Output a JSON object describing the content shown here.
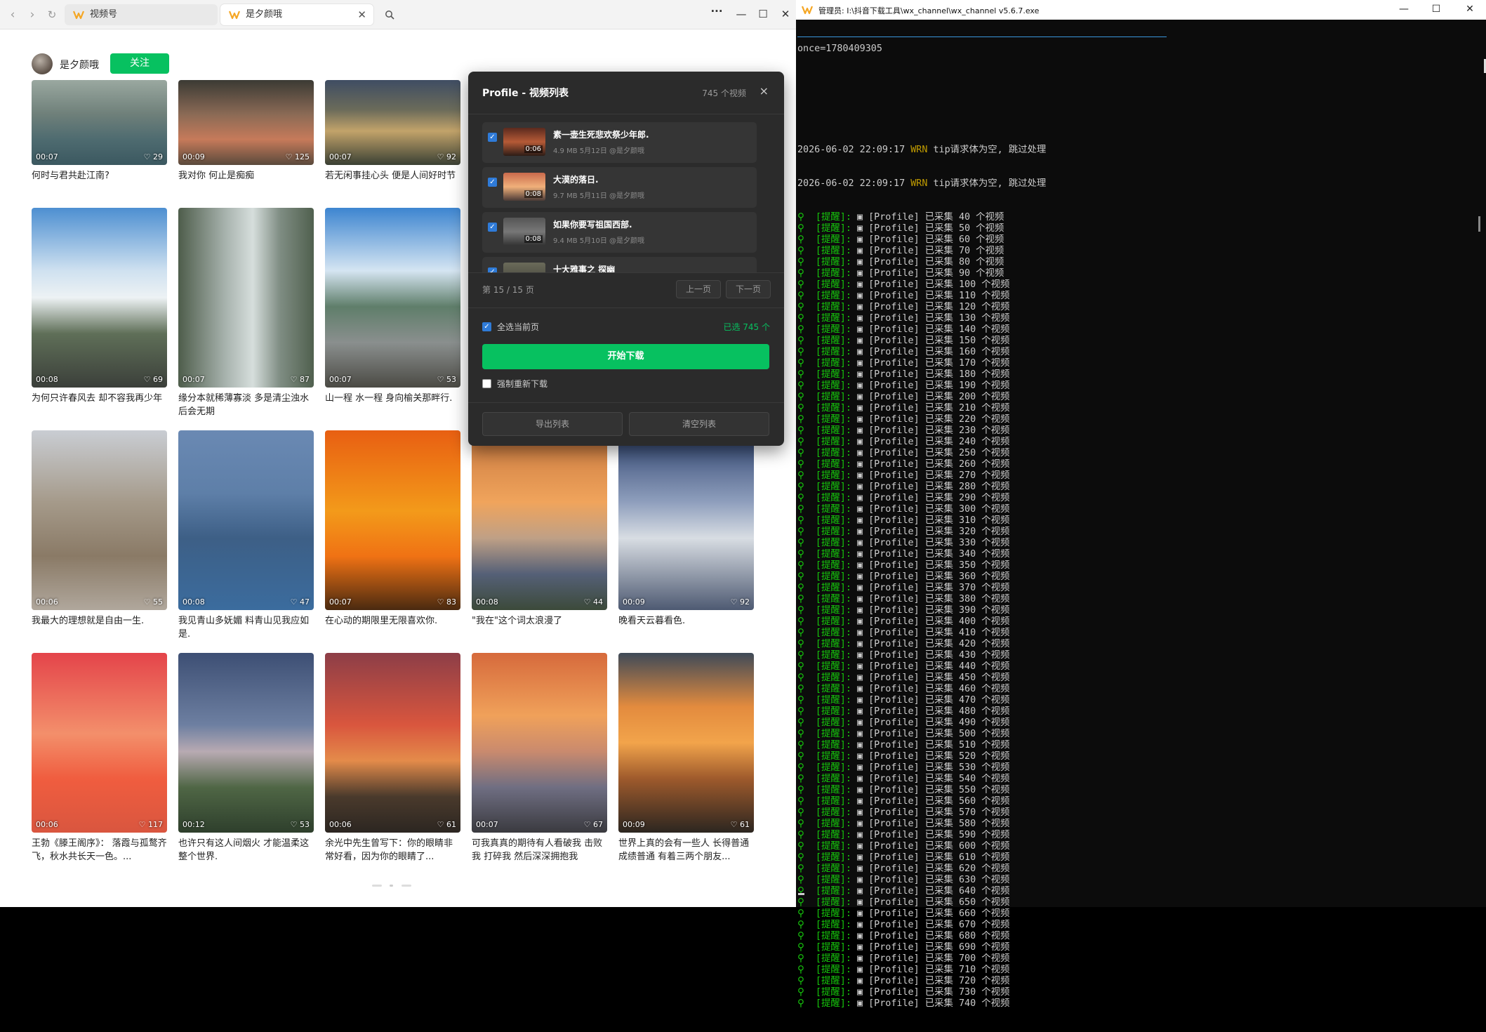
{
  "browser": {
    "tabs": [
      {
        "label": "视频号"
      },
      {
        "label": "是夕颜哦"
      }
    ]
  },
  "profile": {
    "name": "是夕颜哦",
    "follow_label": "关注"
  },
  "feed": [
    {
      "dur": "00:07",
      "likes": "29",
      "title": "何时与君共赴江南?"
    },
    {
      "dur": "00:09",
      "likes": "125",
      "title": "我对你 何止是痴痴"
    },
    {
      "dur": "00:07",
      "likes": "92",
      "title": "若无闲事挂心头 便是人间好时节"
    },
    {
      "dur": "00:08",
      "likes": "69",
      "title": "为何只许春风去 却不容我再少年"
    },
    {
      "dur": "00:07",
      "likes": "87",
      "title": "缘分本就稀薄寡淡 多是清尘浊水后会无期"
    },
    {
      "dur": "00:07",
      "likes": "53",
      "title": "山一程 水一程 身向榆关那畔行."
    },
    {
      "dur": "00:06",
      "likes": "55",
      "title": "我最大的理想就是自由一生."
    },
    {
      "dur": "00:08",
      "likes": "47",
      "title": "我见青山多妩媚 料青山见我应如是."
    },
    {
      "dur": "00:07",
      "likes": "83",
      "title": "在心动的期限里无限喜欢你."
    },
    {
      "dur": "00:08",
      "likes": "44",
      "title": "\"我在\"这个词太浪漫了"
    },
    {
      "dur": "00:09",
      "likes": "92",
      "title": "晚看天云暮看色."
    },
    {
      "dur": "00:06",
      "likes": "117",
      "title": "王勃《滕王阁序》： 落霞与孤鹜齐飞，秋水共长天一色。..."
    },
    {
      "dur": "00:12",
      "likes": "53",
      "title": "也许只有这人间烟火 才能温柔这整个世界."
    },
    {
      "dur": "00:06",
      "likes": "61",
      "title": "余光中先生曾写下：你的眼睛非常好看，因为你的眼睛了..."
    },
    {
      "dur": "00:07",
      "likes": "67",
      "title": "可我真真的期待有人看破我 击败我 打碎我 然后深深拥抱我"
    },
    {
      "dur": "00:09",
      "likes": "61",
      "title": "世界上真的会有一些人 长得普通 成绩普通 有着三两个朋友..."
    }
  ],
  "modal": {
    "title": "Profile - 视频列表",
    "count_label": "745 个视频",
    "close_glyph": "×",
    "items": [
      {
        "thumb_dur": "0:06",
        "title": "素一壶生死悲欢祭少年郎.",
        "size": "4.9 MB",
        "date": "5月12日",
        "author": "@是夕颜哦"
      },
      {
        "thumb_dur": "0:08",
        "title": "大漠的落日.",
        "size": "9.7 MB",
        "date": "5月11日",
        "author": "@是夕颜哦"
      },
      {
        "thumb_dur": "0:08",
        "title": "如果你要写祖国西部.",
        "size": "9.4 MB",
        "date": "5月10日",
        "author": "@是夕颜哦"
      },
      {
        "thumb_dur": "",
        "title": "十大雅事之 探幽",
        "size": "",
        "date": "",
        "author": ""
      }
    ],
    "page_label": "第 15 / 15 页",
    "prev_label": "上一页",
    "next_label": "下一页",
    "select_all_label": "全选当前页",
    "selected_label": "已选 745 个",
    "start_label": "开始下载",
    "force_label": "强制重新下载",
    "export_label": "导出列表",
    "clear_label": "清空列表"
  },
  "console": {
    "title": "管理员: I:\\抖音下载工具\\wx_channel\\wx_channel v5.6.7.exe",
    "nonce_line": "once=1780409305",
    "warn_lines": [
      {
        "time": "2026-06-02 22:09:17",
        "level": "WRN",
        "msg": "tip请求体为空, 跳过处理"
      },
      {
        "time": "2026-06-02 22:09:17",
        "level": "WRN",
        "msg": "tip请求体为空, 跳过处理"
      }
    ],
    "log_tag": "[提醒]:",
    "log_prefix": "[Profile] 已采集",
    "log_suffix": "个视频",
    "counts": [
      40,
      50,
      60,
      70,
      80,
      90,
      100,
      110,
      120,
      130,
      140,
      150,
      160,
      170,
      180,
      190,
      200,
      210,
      220,
      230,
      240,
      250,
      260,
      270,
      280,
      290,
      300,
      310,
      320,
      330,
      340,
      350,
      360,
      370,
      380,
      390,
      400,
      410,
      420,
      430,
      440,
      450,
      460,
      470,
      480,
      490,
      500,
      510,
      520,
      530,
      540,
      550,
      560,
      570,
      580,
      590,
      600,
      610,
      620,
      630,
      640,
      650,
      660,
      670,
      680,
      690,
      700,
      710,
      720,
      730,
      740
    ]
  },
  "colors": {
    "accent_green": "#07c160",
    "console_green": "#16c60c",
    "warn_yellow": "#c19c00"
  }
}
